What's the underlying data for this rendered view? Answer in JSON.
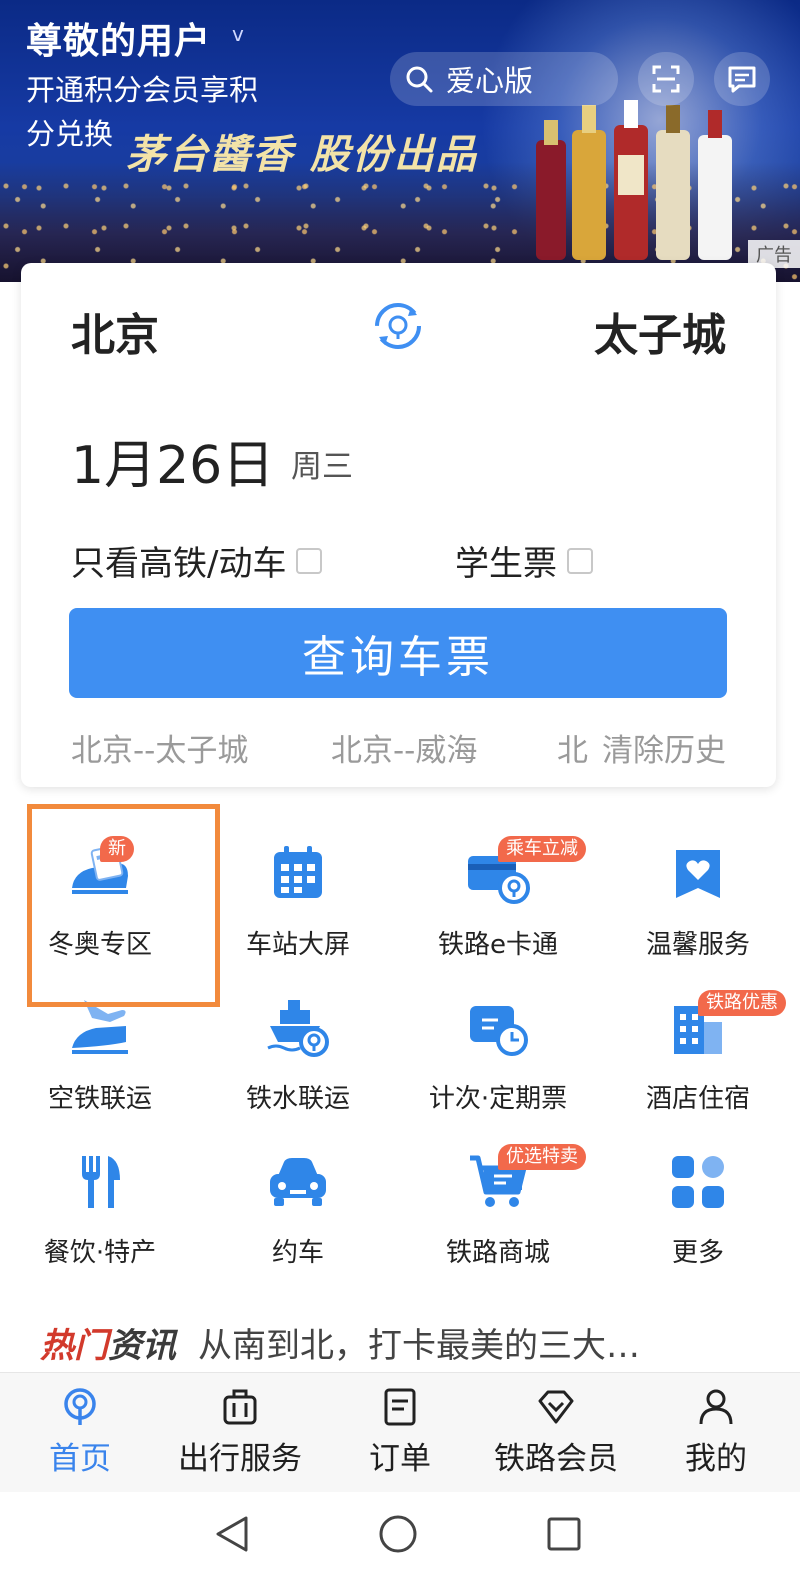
{
  "banner": {
    "user_name": "尊敬的用户",
    "user_caret": "v",
    "member_text": "开通积分会员享积分兑换",
    "ad_slogan": "茅台醬香 股份出品",
    "ad_tag": "广告",
    "search_label": "爱心版"
  },
  "ticket_search": {
    "from_station": "北京",
    "to_station": "太子城",
    "date": "1月26日",
    "weekday": "周三",
    "option_high_speed": "只看高铁/动车",
    "option_student": "学生票",
    "query_button": "查询车票",
    "history": [
      "北京--太子城",
      "北京--威海",
      "北"
    ],
    "clear_history": "清除历史"
  },
  "services": [
    {
      "label": "冬奥专区",
      "icon": "winter-olympics-train-icon",
      "badge": "新"
    },
    {
      "label": "车站大屏",
      "icon": "calendar-screen-icon",
      "badge": ""
    },
    {
      "label": "铁路e卡通",
      "icon": "railway-card-icon",
      "badge": "乘车立减"
    },
    {
      "label": "温馨服务",
      "icon": "heart-service-icon",
      "badge": ""
    },
    {
      "label": "空铁联运",
      "icon": "air-rail-icon",
      "badge": ""
    },
    {
      "label": "铁水联运",
      "icon": "rail-ship-icon",
      "badge": ""
    },
    {
      "label": "计次·定期票",
      "icon": "period-ticket-icon",
      "badge": ""
    },
    {
      "label": "酒店住宿",
      "icon": "hotel-icon",
      "badge": "铁路优惠"
    },
    {
      "label": "餐饮·特产",
      "icon": "dining-icon",
      "badge": ""
    },
    {
      "label": "约车",
      "icon": "car-icon",
      "badge": ""
    },
    {
      "label": "铁路商城",
      "icon": "shopping-cart-icon",
      "badge": "优选特卖"
    },
    {
      "label": "更多",
      "icon": "more-grid-icon",
      "badge": ""
    }
  ],
  "news": {
    "tag_a": "热门",
    "tag_b": "资讯",
    "headline": "从南到北，打卡最美的三大…"
  },
  "tabbar": [
    {
      "label": "首页",
      "icon": "home-rail-icon",
      "active": true
    },
    {
      "label": "出行服务",
      "icon": "luggage-icon",
      "active": false
    },
    {
      "label": "订单",
      "icon": "order-icon",
      "active": false
    },
    {
      "label": "铁路会员",
      "icon": "diamond-icon",
      "active": false
    },
    {
      "label": "我的",
      "icon": "person-icon",
      "active": false
    }
  ],
  "colors": {
    "accent_blue": "#3f8ff2",
    "icon_blue": "#2f86e8",
    "badge_red": "#f2694b",
    "highlight_orange": "#f28a3c"
  }
}
